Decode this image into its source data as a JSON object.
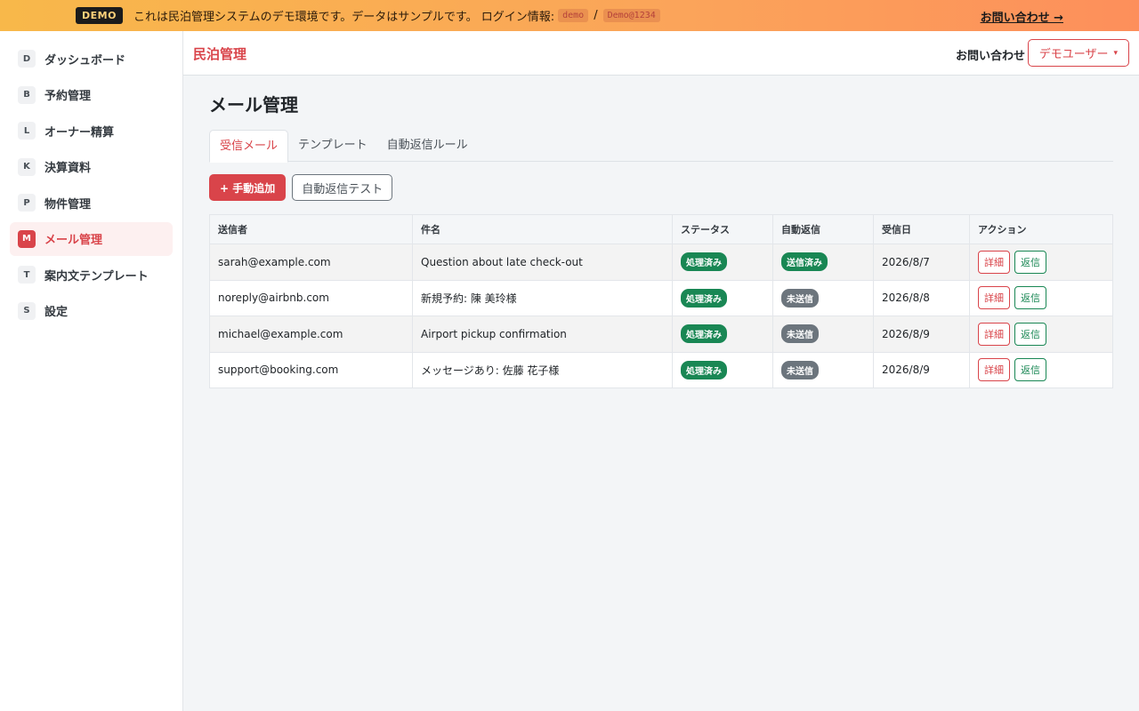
{
  "banner": {
    "badge": "DEMO",
    "text": "これは民泊管理システムのデモ環境です。データはサンプルです。 ログイン情報:",
    "user_code": "demo",
    "separator": "/",
    "password_code": "Demo@1234",
    "contact_link": "お問い合わせ →"
  },
  "sidebar": {
    "items": [
      {
        "letter": "D",
        "label": "ダッシュボード"
      },
      {
        "letter": "B",
        "label": "予約管理"
      },
      {
        "letter": "L",
        "label": "オーナー精算"
      },
      {
        "letter": "K",
        "label": "決算資料"
      },
      {
        "letter": "P",
        "label": "物件管理"
      },
      {
        "letter": "M",
        "label": "メール管理",
        "active": true
      },
      {
        "letter": "T",
        "label": "案内文テンプレート"
      },
      {
        "letter": "S",
        "label": "設定"
      }
    ]
  },
  "header": {
    "brand": "民泊管理",
    "contact": "お問い合わせ",
    "user_menu": "デモユーザー",
    "caret": "▾"
  },
  "main": {
    "title": "メール管理",
    "tabs": [
      "受信メール",
      "テンプレート",
      "自動返信ルール"
    ],
    "active_tab": 0,
    "buttons": {
      "manual_add": "+ 手動追加",
      "auto_reply_test": "自動返信テスト"
    },
    "table": {
      "headers": [
        "送信者",
        "件名",
        "ステータス",
        "自動返信",
        "受信日",
        "アクション"
      ],
      "rows": [
        {
          "sender": "sarah@example.com",
          "subject": "Question about late check-out",
          "status": "処理済み",
          "auto_reply": "送信済み",
          "date": "2026/8/7",
          "detail": "詳細",
          "reply": "返信"
        },
        {
          "sender": "noreply@airbnb.com",
          "subject": "新規予約: 陳 美玲様",
          "status": "処理済み",
          "auto_reply": "未送信",
          "date": "2026/8/8",
          "detail": "詳細",
          "reply": "返信"
        },
        {
          "sender": "michael@example.com",
          "subject": "Airport pickup confirmation",
          "status": "処理済み",
          "auto_reply": "未送信",
          "date": "2026/8/9",
          "detail": "詳細",
          "reply": "返信"
        },
        {
          "sender": "support@booking.com",
          "subject": "メッセージあり: 佐藤 花子様",
          "status": "処理済み",
          "auto_reply": "未送信",
          "date": "2026/8/9",
          "detail": "詳細",
          "reply": "返信"
        }
      ]
    }
  },
  "colors": {
    "accent": "#d9444a",
    "success": "#198754",
    "muted": "#6c757d"
  }
}
